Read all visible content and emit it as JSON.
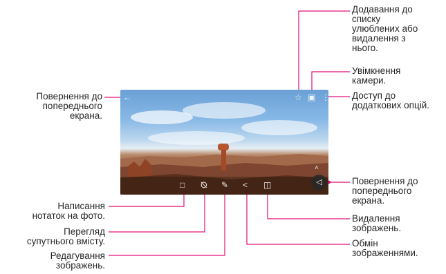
{
  "callouts": {
    "favorites": "Додавання до\nсписку\nулюблених або\nвидалення з\nнього.",
    "camera": "Увімкнення\nкамери.",
    "options": "Доступ до\nдодаткових опцій.",
    "back_left": "Повернення до\nпопереднього\nекрана.",
    "back_right": "Повернення до\nпопереднього\nекрана.",
    "notes": "Написання\nнотаток на фото.",
    "related": "Перегляд\nсупутнього вмісту.",
    "edit": "Редагування\nзображень.",
    "delete": "Видалення\nзображень.",
    "share": "Обмін\nзображеннями."
  },
  "icons": {
    "back": "arrow-left-icon",
    "star": "star-icon",
    "camera": "camera-icon",
    "more": "more-vertical-icon",
    "note": "note-icon",
    "related": "related-content-icon",
    "edit": "pencil-icon",
    "share": "share-icon",
    "delete": "trash-icon",
    "nav_back": "nav-back-icon",
    "expand": "chevron-up-icon"
  },
  "colors": {
    "callout_line": "#e0107a"
  }
}
